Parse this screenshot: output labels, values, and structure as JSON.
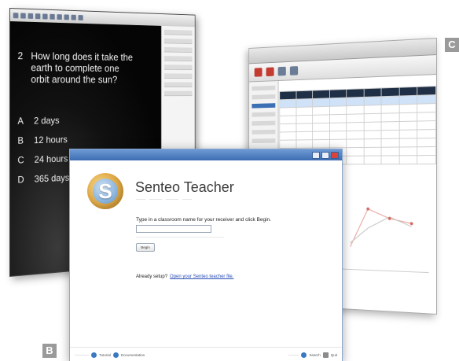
{
  "callouts": {
    "b": "B",
    "c": "C"
  },
  "quiz": {
    "question_number": "2",
    "question": "How long does it take the earth to complete one orbit around the sun?",
    "answers": [
      {
        "letter": "A",
        "text": "2 days"
      },
      {
        "letter": "B",
        "text": "12 hours"
      },
      {
        "letter": "C",
        "text": "24 hours"
      },
      {
        "letter": "D",
        "text": "365 days"
      }
    ]
  },
  "main": {
    "app_title": "Senteo Teacher",
    "logo_letter": "S",
    "prompt": "Type in a classroom name for your receiver and click Begin.",
    "begin_label": "Begin",
    "setup_question": "Already setup?",
    "setup_link": "Open your Senteo teacher file."
  },
  "footer": {
    "help_label": "Tutorial",
    "doc_label": "Documentation",
    "search_label": "Search",
    "quit_label": "Quit"
  },
  "colors": {
    "titlebar": "#3d6db3",
    "link": "#2a4cb5",
    "logo_outer": "#e4b04e",
    "logo_inner": "#8db6de",
    "callout": "#9a9a9a"
  },
  "icons": [
    "search-icon",
    "quit-icon",
    "help-icon",
    "documentation-icon"
  ]
}
